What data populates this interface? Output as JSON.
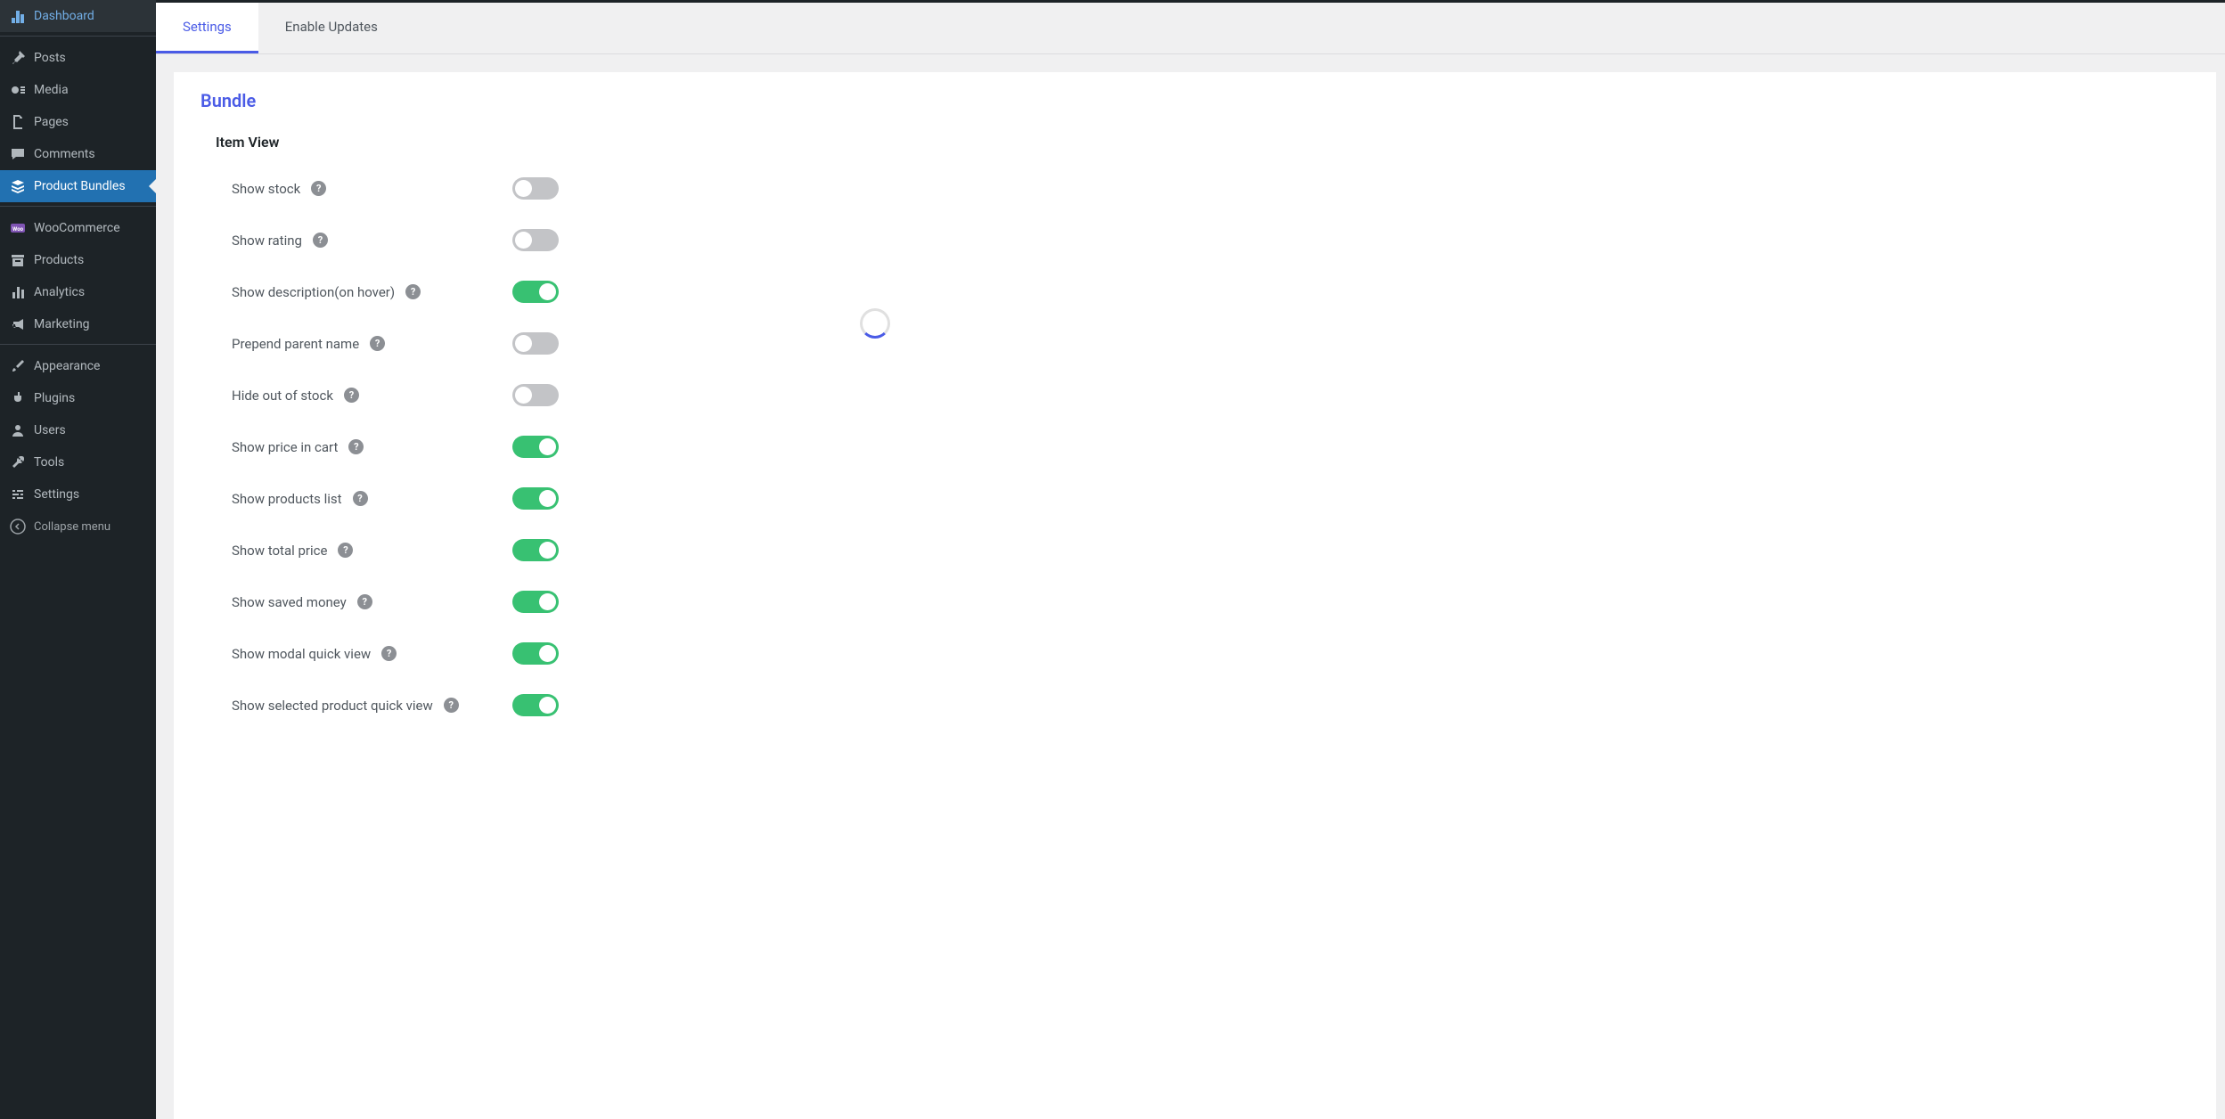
{
  "sidebar": {
    "items": [
      {
        "label": "Dashboard",
        "icon": "dashboard"
      },
      {
        "label": "Posts",
        "icon": "pin"
      },
      {
        "label": "Media",
        "icon": "media"
      },
      {
        "label": "Pages",
        "icon": "page"
      },
      {
        "label": "Comments",
        "icon": "comment"
      },
      {
        "label": "Product Bundles",
        "icon": "layers",
        "active": true
      },
      {
        "label": "WooCommerce",
        "icon": "woo"
      },
      {
        "label": "Products",
        "icon": "archive"
      },
      {
        "label": "Analytics",
        "icon": "chart"
      },
      {
        "label": "Marketing",
        "icon": "megaphone"
      },
      {
        "label": "Appearance",
        "icon": "brush"
      },
      {
        "label": "Plugins",
        "icon": "plug"
      },
      {
        "label": "Users",
        "icon": "user"
      },
      {
        "label": "Tools",
        "icon": "wrench"
      },
      {
        "label": "Settings",
        "icon": "sliders"
      }
    ],
    "collapse_label": "Collapse menu"
  },
  "tabs": [
    {
      "label": "Settings",
      "active": true
    },
    {
      "label": "Enable Updates",
      "active": false
    }
  ],
  "panel": {
    "title": "Bundle",
    "subsection": "Item View",
    "settings": [
      {
        "label": "Show stock",
        "on": false
      },
      {
        "label": "Show rating",
        "on": false
      },
      {
        "label": "Show description(on hover)",
        "on": true
      },
      {
        "label": "Prepend parent name",
        "on": false
      },
      {
        "label": "Hide out of stock",
        "on": false
      },
      {
        "label": "Show price in cart",
        "on": true
      },
      {
        "label": "Show products list",
        "on": true
      },
      {
        "label": "Show total price",
        "on": true
      },
      {
        "label": "Show saved money",
        "on": true
      },
      {
        "label": "Show modal quick view",
        "on": true
      },
      {
        "label": "Show selected product quick view",
        "on": true
      }
    ]
  }
}
